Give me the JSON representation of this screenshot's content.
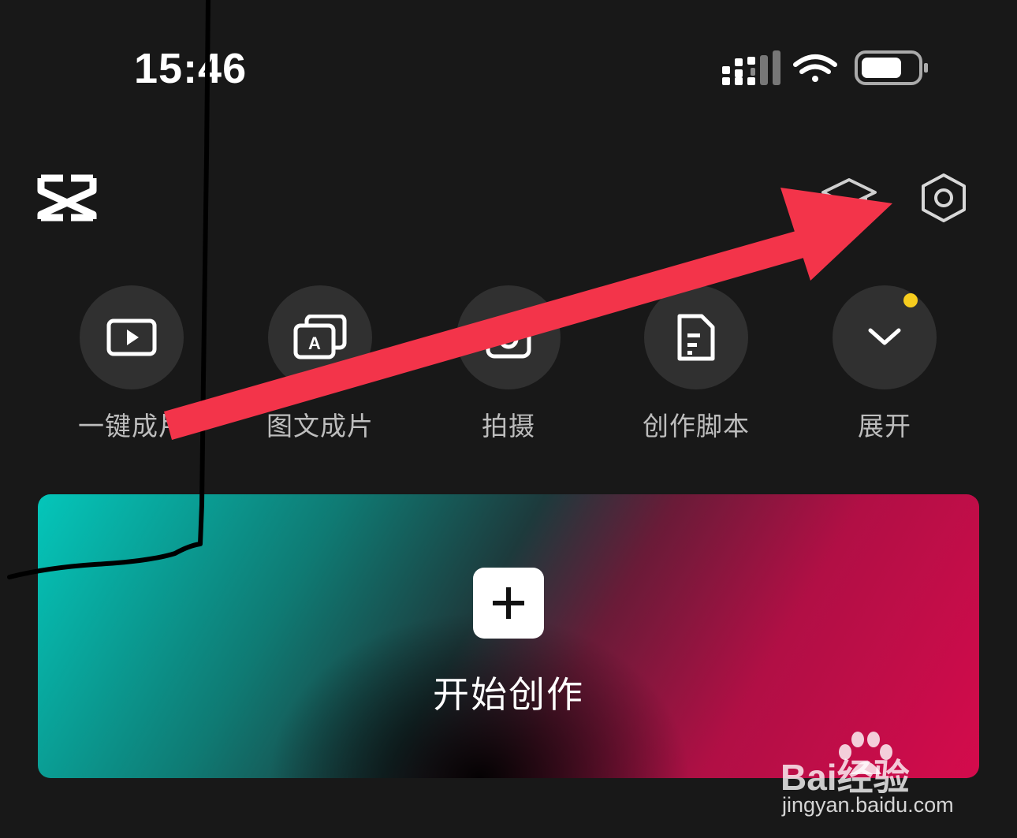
{
  "status_bar": {
    "time": "15:46",
    "icons": [
      "cellular-signal-icon",
      "wifi-icon",
      "battery-icon"
    ]
  },
  "header": {
    "logo_icon": "capcut-logo",
    "actions": [
      {
        "icon": "graduation-cap-icon"
      },
      {
        "icon": "settings-gear-icon"
      }
    ]
  },
  "tools": [
    {
      "label": "一键成片",
      "icon": "play-video-icon"
    },
    {
      "label": "图文成片",
      "icon": "text-to-video-icon"
    },
    {
      "label": "拍摄",
      "icon": "camera-icon"
    },
    {
      "label": "创作脚本",
      "icon": "script-document-icon"
    },
    {
      "label": "展开",
      "icon": "chevron-down-icon",
      "has_badge_dot": true
    }
  ],
  "create": {
    "label": "开始创作",
    "icon": "plus-icon"
  },
  "watermark": {
    "brand": "Bai经验",
    "url": "jingyan.baidu.com"
  },
  "colors": {
    "background": "#181818",
    "tool_circle": "#303030",
    "badge_dot": "#f6cc1e",
    "annotation_arrow": "#f3344a",
    "gradient_teal": "#04c6ba",
    "gradient_pink": "#d40b4c"
  }
}
